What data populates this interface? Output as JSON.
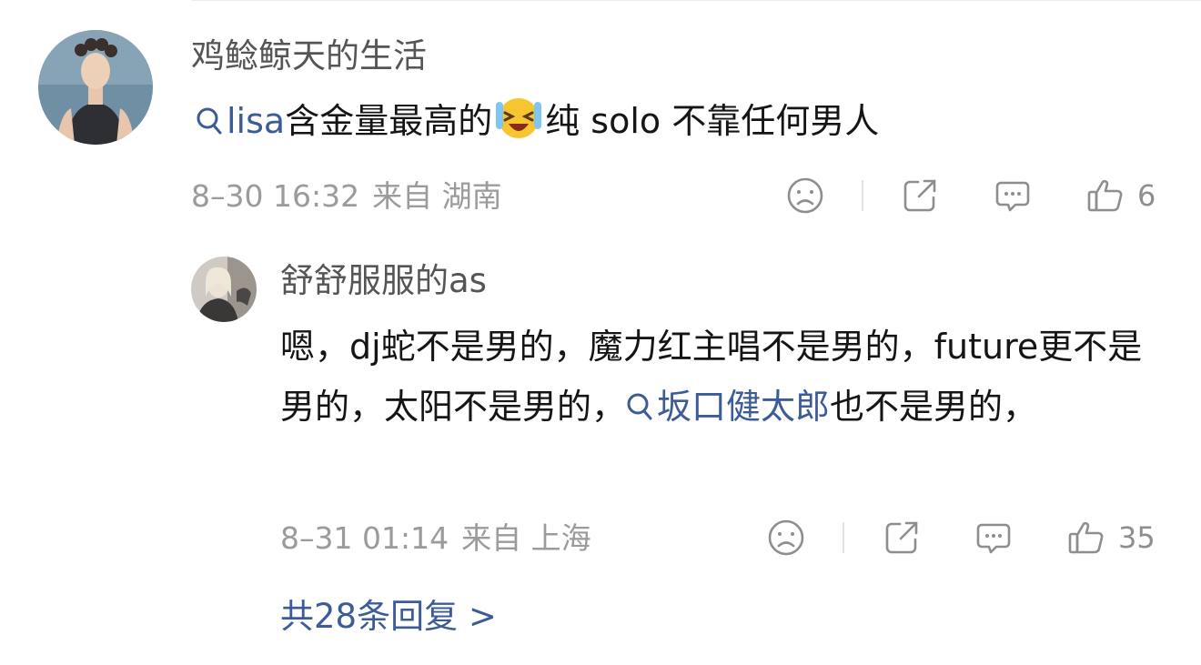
{
  "comment": {
    "username": "鸡鲶鲸天的生活",
    "tag": "lisa",
    "text_before_emoji": "含金量最高的",
    "emoji": "laughing-crying-emoji",
    "text_after_emoji": "纯 solo 不靠任何男人",
    "time": "8–30 16:32",
    "location": "来自 湖南",
    "likes": "6"
  },
  "reply": {
    "username": "舒舒服服的as",
    "text_part1": "嗯，dj蛇不是男的，魔力红主唱不是男的，future更不是男的，太阳不是男的，",
    "tag": "坂口健太郎",
    "text_part2": "也不是男的，",
    "time": "8–31 01:14",
    "location": "来自 上海",
    "likes": "35"
  },
  "more_replies": "共28条回复 >",
  "icons": {
    "dislike": "sad-face-icon",
    "share": "share-icon",
    "comment": "comment-icon",
    "like": "thumbs-up-icon",
    "tag_search": "search-icon"
  },
  "colors": {
    "link": "#3c5c98",
    "meta": "#9b9b9b",
    "username": "#555555"
  }
}
